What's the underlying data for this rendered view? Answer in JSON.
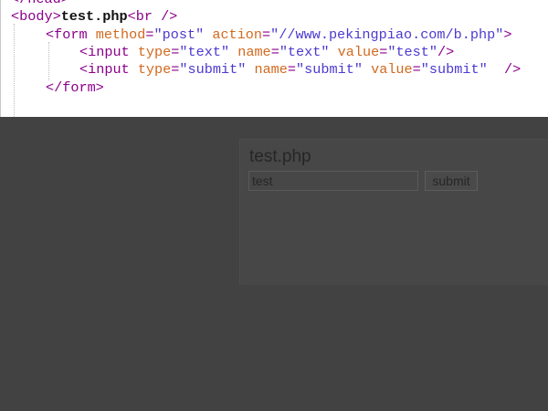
{
  "editor": {
    "lines": [
      {
        "tag": "</head>"
      },
      {
        "open": "<body>",
        "text": "test.php",
        "br": "<br />"
      },
      {
        "tag_open": "<form",
        "attr1": "method",
        "eq1": "=",
        "val1": "\"post\"",
        "attr2": "action",
        "eq2": "=",
        "val2": "\"//www.pekingpiao.com/b.php\"",
        "close": ">"
      },
      {
        "tag_open": "<input",
        "attr1": "type",
        "eq1": "=",
        "val1": "\"text\"",
        "attr2": "name",
        "eq2": "=",
        "val2": "\"text\"",
        "attr3": "value",
        "eq3": "=",
        "val3": "\"test\"",
        "close": "/>"
      },
      {
        "tag_open": "<input",
        "attr1": "type",
        "eq1": "=",
        "val1": "\"submit\"",
        "attr2": "name",
        "eq2": "=",
        "val2": "\"submit\"",
        "attr3": "value",
        "eq3": "=",
        "val3": "\"submit\"",
        "close": "/>"
      },
      {
        "tag": "</form>"
      }
    ]
  },
  "preview": {
    "title": "test.php",
    "input_value": "test",
    "submit_label": "submit"
  }
}
